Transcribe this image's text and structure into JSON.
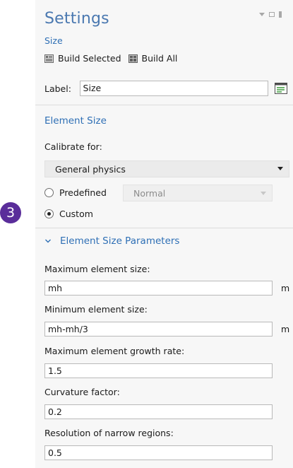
{
  "header": {
    "title": "Settings",
    "subtitle": "Size",
    "window_controls": [
      "triangle-down-icon",
      "restore-icon",
      "pin-icon"
    ]
  },
  "toolbar": {
    "build_selected_label": "Build Selected",
    "build_all_label": "Build All"
  },
  "label_row": {
    "label": "Label:",
    "value": "Size"
  },
  "element_size": {
    "section_title": "Element Size",
    "calibrate_label": "Calibrate for:",
    "calibrate_value": "General physics",
    "predefined_label": "Predefined",
    "predefined_value": "Normal",
    "custom_label": "Custom",
    "selected_option": "Custom"
  },
  "badge": {
    "number": "3",
    "color": "#5a2d9a"
  },
  "parameters": {
    "section_title": "Element Size Parameters",
    "fields": [
      {
        "label": "Maximum element size:",
        "value": "mh",
        "unit": "m"
      },
      {
        "label": "Minimum element size:",
        "value": "mh-mh/3",
        "unit": "m"
      },
      {
        "label": "Maximum element growth rate:",
        "value": "1.5",
        "unit": ""
      },
      {
        "label": "Curvature factor:",
        "value": "0.2",
        "unit": ""
      },
      {
        "label": "Resolution of narrow regions:",
        "value": "0.5",
        "unit": ""
      }
    ]
  },
  "colors": {
    "accent": "#2e6fb5",
    "title": "#4a78b0",
    "panel_bg": "#f7f7f7"
  }
}
